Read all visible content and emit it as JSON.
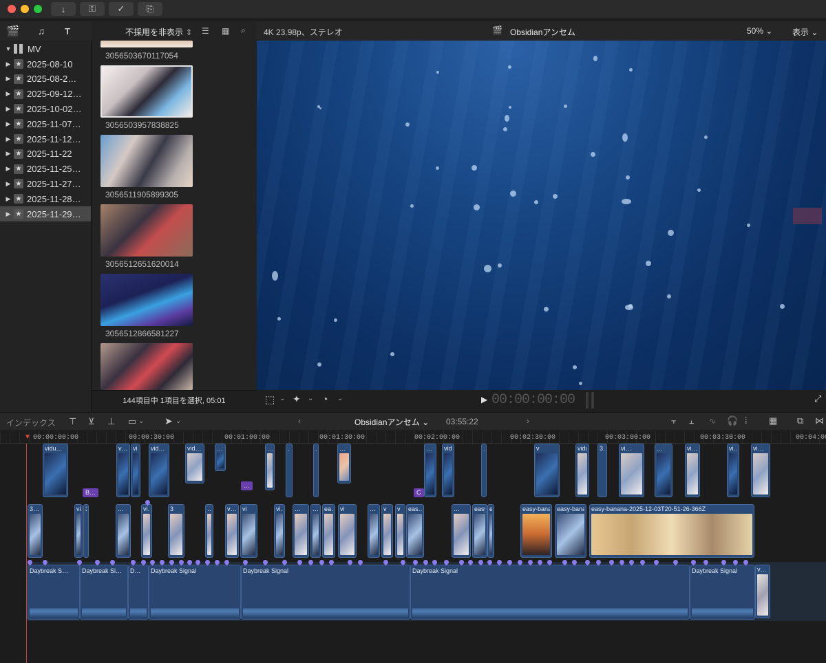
{
  "toolbar": {
    "buttons": [
      "import-icon",
      "key-icon",
      "check-icon",
      "share-icon"
    ]
  },
  "browser": {
    "filter_label": "不採用を非表示",
    "status": "144項目中 1項目を選択, 05:01",
    "clips": [
      {
        "label": "3056503670117054"
      },
      {
        "label": "3056503957838825"
      },
      {
        "label": "3056511905899305"
      },
      {
        "label": "3056512651620014"
      },
      {
        "label": "3056512866581227"
      },
      {
        "label": ""
      }
    ]
  },
  "library": {
    "name": "MV",
    "events": [
      "2025-08-10",
      "2025-08-2…",
      "2025-09-12…",
      "2025-10-02…",
      "2025-11-07…",
      "2025-11-12…",
      "2025-11-22",
      "2025-11-25…",
      "2025-11-27…",
      "2025-11-28…",
      "2025-11-29…"
    ]
  },
  "viewer": {
    "format": "4K 23.98p、ステレオ",
    "project": "Obsidianアンセム",
    "zoom": "50%",
    "view_menu": "表示",
    "timecode": "00:00:00:00"
  },
  "timeline": {
    "index_label": "インデックス",
    "project": "Obsidianアンセム",
    "duration": "03:55:22",
    "ruler": [
      "00:00:00:00",
      "00:00:30:00",
      "00:01:00:00",
      "00:01:30:00",
      "00:02:00:00",
      "00:02:30:00",
      "00:03:00:00",
      "00:03:30:00",
      "00:04:00"
    ],
    "upper_clips": [
      "vidu…",
      "v…",
      "vi",
      "vid…",
      "vid…",
      "…",
      "…",
      "…",
      "…",
      "…",
      "…",
      "vidu…",
      "…",
      "v",
      "vidu…",
      "3…",
      "vi…",
      "…",
      "vi…"
    ],
    "main_clips": [
      "3…",
      "vi",
      "3…",
      "…",
      "vi…",
      "3",
      "…",
      "v…",
      "vi",
      "vi…",
      "…",
      "…",
      "ea…",
      "vi",
      "…",
      "v",
      "v",
      "eas…",
      "…",
      "easy-b…",
      "easy-b…",
      "easy-banana-2025-12-03T20-51-26-366Z"
    ],
    "audio_clips": [
      "Daybreak S…",
      "Daybreak Si…",
      "D…",
      "Daybreak Signal",
      "Daybreak Signal",
      "Daybreak Signal",
      "Daybreak Signal",
      "v…"
    ],
    "badges": [
      "B…",
      "…",
      "C"
    ]
  }
}
